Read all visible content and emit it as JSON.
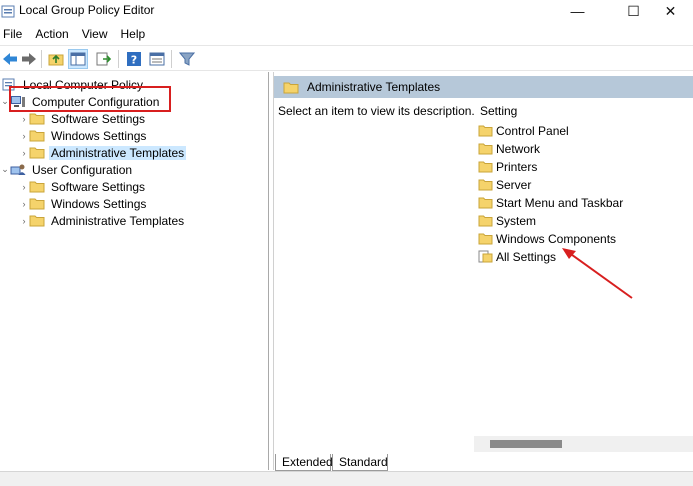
{
  "window": {
    "title": "Local Group Policy Editor",
    "minimize": "—",
    "maximize": "☐",
    "close": "✕"
  },
  "menu": [
    "File",
    "Action",
    "View",
    "Help"
  ],
  "toolbar": [
    "back-arrow",
    "forward-arrow",
    "up-folder",
    "show-hide-tree",
    "export-list",
    "help",
    "properties",
    "filter"
  ],
  "tree": {
    "root": "Local Computer Policy",
    "nodes": [
      {
        "label": "Computer Configuration",
        "icon": "computer-icon",
        "expanded": true
      },
      {
        "label": "Software Settings",
        "icon": "folder-icon"
      },
      {
        "label": "Windows Settings",
        "icon": "folder-icon"
      },
      {
        "label": "Administrative Templates",
        "icon": "folder-icon",
        "selected": true
      },
      {
        "label": "User Configuration",
        "icon": "user-icon",
        "expanded": true
      },
      {
        "label": "Software Settings",
        "icon": "folder-icon"
      },
      {
        "label": "Windows Settings",
        "icon": "folder-icon"
      },
      {
        "label": "Administrative Templates",
        "icon": "folder-icon"
      }
    ]
  },
  "details": {
    "header": "Administrative Templates",
    "description": "Select an item to view its description.",
    "column": "Setting",
    "items": [
      "Control Panel",
      "Network",
      "Printers",
      "Server",
      "Start Menu and Taskbar",
      "System",
      "Windows Components",
      "All Settings"
    ]
  },
  "tabs": [
    "Extended",
    "Standard"
  ],
  "colors": {
    "highlight": "#d81f1f",
    "selection": "#cce8ff",
    "header": "#b6c8d9",
    "folder": "#f5d36b"
  }
}
